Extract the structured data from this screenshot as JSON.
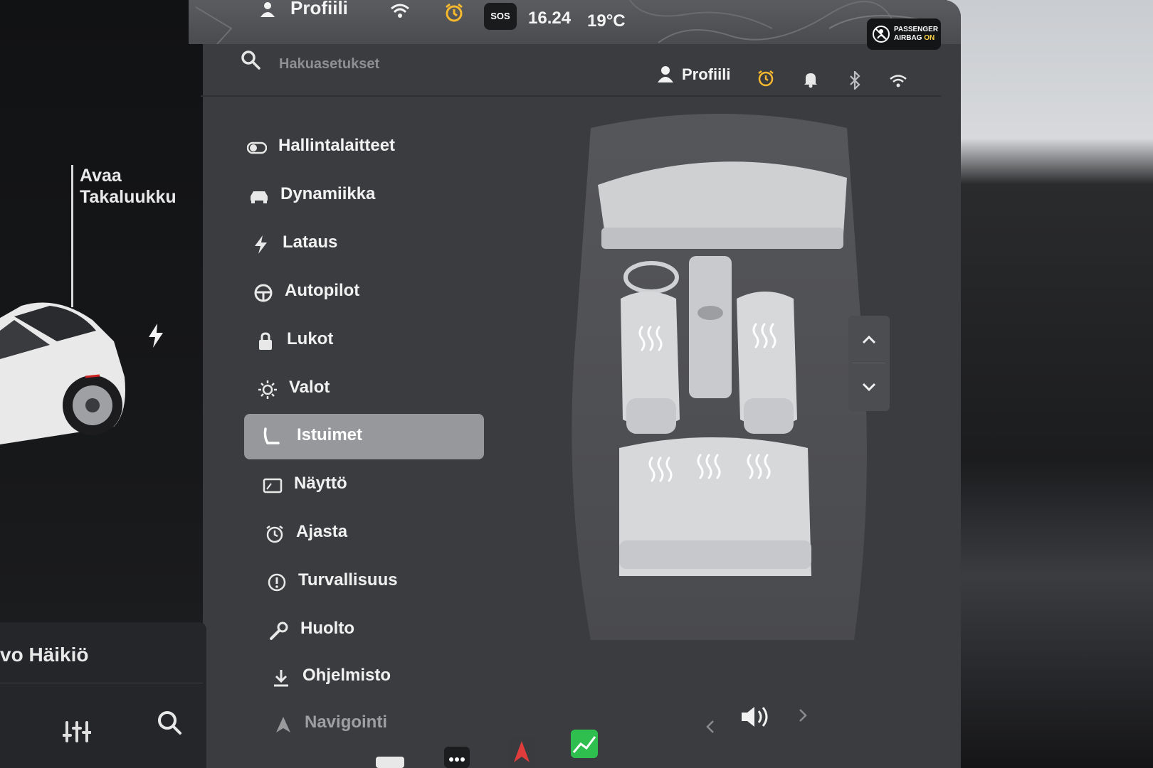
{
  "status_bar": {
    "profile_label": "Profiili",
    "sos_label": "SOS",
    "time": "16.24",
    "temperature": "19°C",
    "airbag_line1": "PASSENGER",
    "airbag_line2": "AIRBAG",
    "airbag_state": "ON",
    "alarm_color": "#f5b82e"
  },
  "car_panel": {
    "trunk_line1": "Avaa",
    "trunk_line2": "Takaluukku",
    "driver_name": "vo Häikiö"
  },
  "settings": {
    "search_placeholder": "Hakuasetukset",
    "profile_label": "Profiili",
    "menu": [
      {
        "label": "Hallintalaitteet",
        "icon": "toggle-icon",
        "active": false
      },
      {
        "label": "Dynamiikka",
        "icon": "car-icon",
        "active": false
      },
      {
        "label": "Lataus",
        "icon": "bolt-icon",
        "active": false
      },
      {
        "label": "Autopilot",
        "icon": "steering-wheel-icon",
        "active": false
      },
      {
        "label": "Lukot",
        "icon": "lock-icon",
        "active": false
      },
      {
        "label": "Valot",
        "icon": "sun-icon",
        "active": false
      },
      {
        "label": "Istuimet",
        "icon": "seat-icon",
        "active": true
      },
      {
        "label": "Näyttö",
        "icon": "display-icon",
        "active": false
      },
      {
        "label": "Ajasta",
        "icon": "alarm-clock-icon",
        "active": false
      },
      {
        "label": "Turvallisuus",
        "icon": "alert-circle-icon",
        "active": false
      },
      {
        "label": "Huolto",
        "icon": "wrench-icon",
        "active": false
      },
      {
        "label": "Ohjelmisto",
        "icon": "download-icon",
        "active": false
      },
      {
        "label": "Navigointi",
        "icon": "navigation-icon",
        "active": false
      }
    ]
  },
  "colors": {
    "accent_alarm": "#f5b82e",
    "active_item": "#97989c",
    "app_green": "#2fbf4f"
  }
}
